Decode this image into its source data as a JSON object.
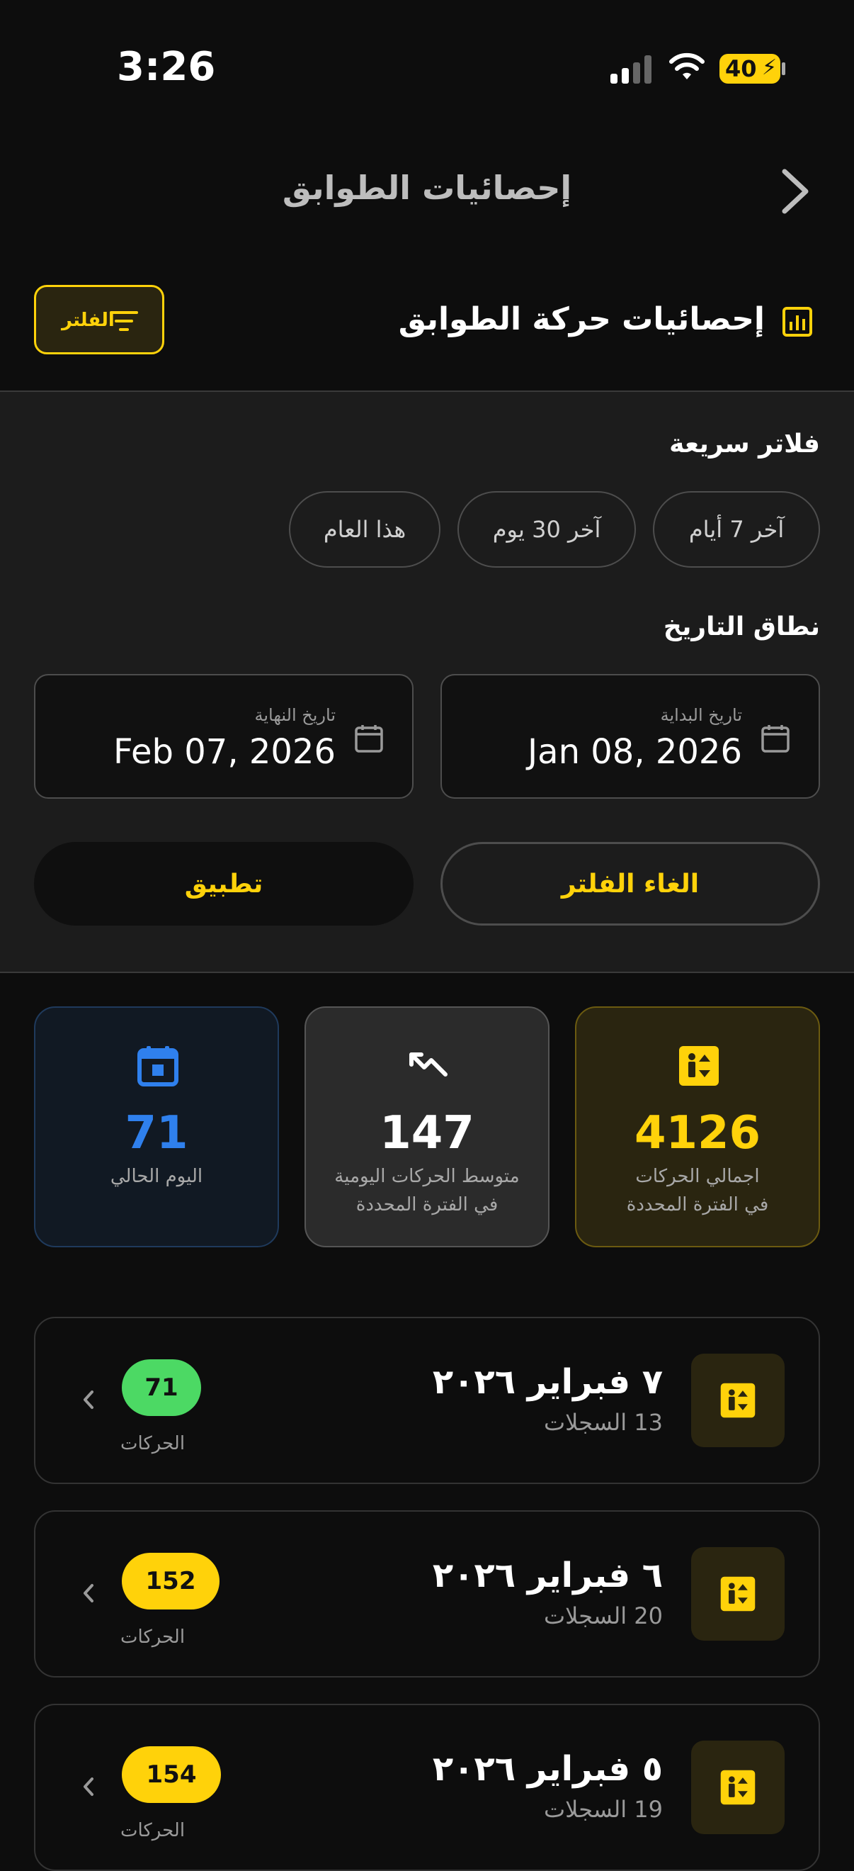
{
  "status_bar": {
    "time": "3:26",
    "battery": "40"
  },
  "nav": {
    "title": "إحصائيات الطوابق"
  },
  "header": {
    "title": "إحصائيات حركة الطوابق",
    "filter_label": "الفلتر"
  },
  "filters": {
    "quick_title": "فلاتر سريعة",
    "chips": [
      "آخر 7 أيام",
      "آخر 30 يوم",
      "هذا العام"
    ],
    "range_title": "نطاق التاريخ",
    "start_caption": "تاريخ البداية",
    "start_value": "Jan 08, 2026",
    "end_caption": "تاريخ النهاية",
    "end_value": "Feb 07, 2026",
    "clear_label": "الغاء الفلتر",
    "apply_label": "تطبيق"
  },
  "stats": {
    "total": {
      "value": "4126",
      "caption_1": "اجمالي الحركات",
      "caption_2": "في الفترة المحددة"
    },
    "average": {
      "value": "147",
      "caption_1": "متوسط الحركات اليومية",
      "caption_2": "في الفترة المحددة"
    },
    "today": {
      "value": "71",
      "caption_1": "اليوم الحالي"
    }
  },
  "days": [
    {
      "date": "٧ فبراير ٢٠٢٦",
      "records": "13 السجلات",
      "moves": "71",
      "moves_label": "الحركات"
    },
    {
      "date": "٦ فبراير ٢٠٢٦",
      "records": "20 السجلات",
      "moves": "152",
      "moves_label": "الحركات"
    },
    {
      "date": "٥ فبراير ٢٠٢٦",
      "records": "19 السجلات",
      "moves": "154",
      "moves_label": "الحركات"
    }
  ],
  "colors": {
    "accent": "#ffd20a",
    "green": "#4cd964",
    "blue": "#2f80ed"
  }
}
